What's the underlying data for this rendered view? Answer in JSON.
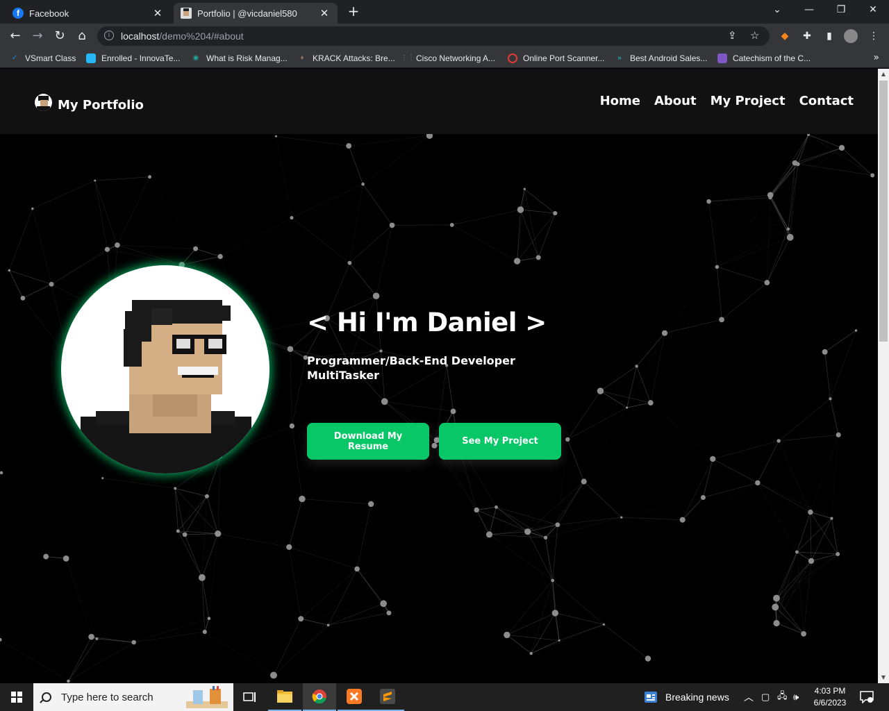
{
  "browser": {
    "tabs": [
      {
        "title": "Facebook",
        "icon": "facebook-icon",
        "active": false
      },
      {
        "title": "Portfolio | @vicdaniel580",
        "icon": "portfolio-favicon",
        "active": true
      }
    ],
    "url_host": "localhost",
    "url_path": "/demo%204/#about",
    "bookmarks": [
      {
        "label": "VSmart Class",
        "icon": "vsmart-icon",
        "color": "#1e88e5"
      },
      {
        "label": "Enrolled - InnovaTe...",
        "icon": "innovate-icon",
        "color": "#29b6f6"
      },
      {
        "label": "What is Risk Manag...",
        "icon": "eye-icon",
        "color": "#26a69a"
      },
      {
        "label": "KRACK Attacks: Bre...",
        "icon": "krack-icon",
        "color": "#8d6e63"
      },
      {
        "label": "Cisco Networking A...",
        "icon": "cisco-icon",
        "color": "#555555"
      },
      {
        "label": "Online Port Scanner...",
        "icon": "port-scanner-icon",
        "color": "#e53935"
      },
      {
        "label": "Best Android Sales...",
        "icon": "android-sales-icon",
        "color": "#26c6da"
      },
      {
        "label": "Catechism of the C...",
        "icon": "catechism-icon",
        "color": "#7e57c2"
      }
    ]
  },
  "site": {
    "brand": "My Portfolio",
    "nav": [
      "Home",
      "About",
      "My Project",
      "Contact"
    ],
    "hero": {
      "title": "< Hi I'm Daniel >",
      "subtitle_line1": "Programmer/Back-End Developer",
      "subtitle_line2": "MultiTasker",
      "btn_resume": "Download My Resume",
      "btn_project": "See My Project"
    },
    "accent_color": "#08c767"
  },
  "taskbar": {
    "search_placeholder": "Type here to search",
    "news": "Breaking news",
    "time": "4:03 PM",
    "date": "6/6/2023"
  }
}
